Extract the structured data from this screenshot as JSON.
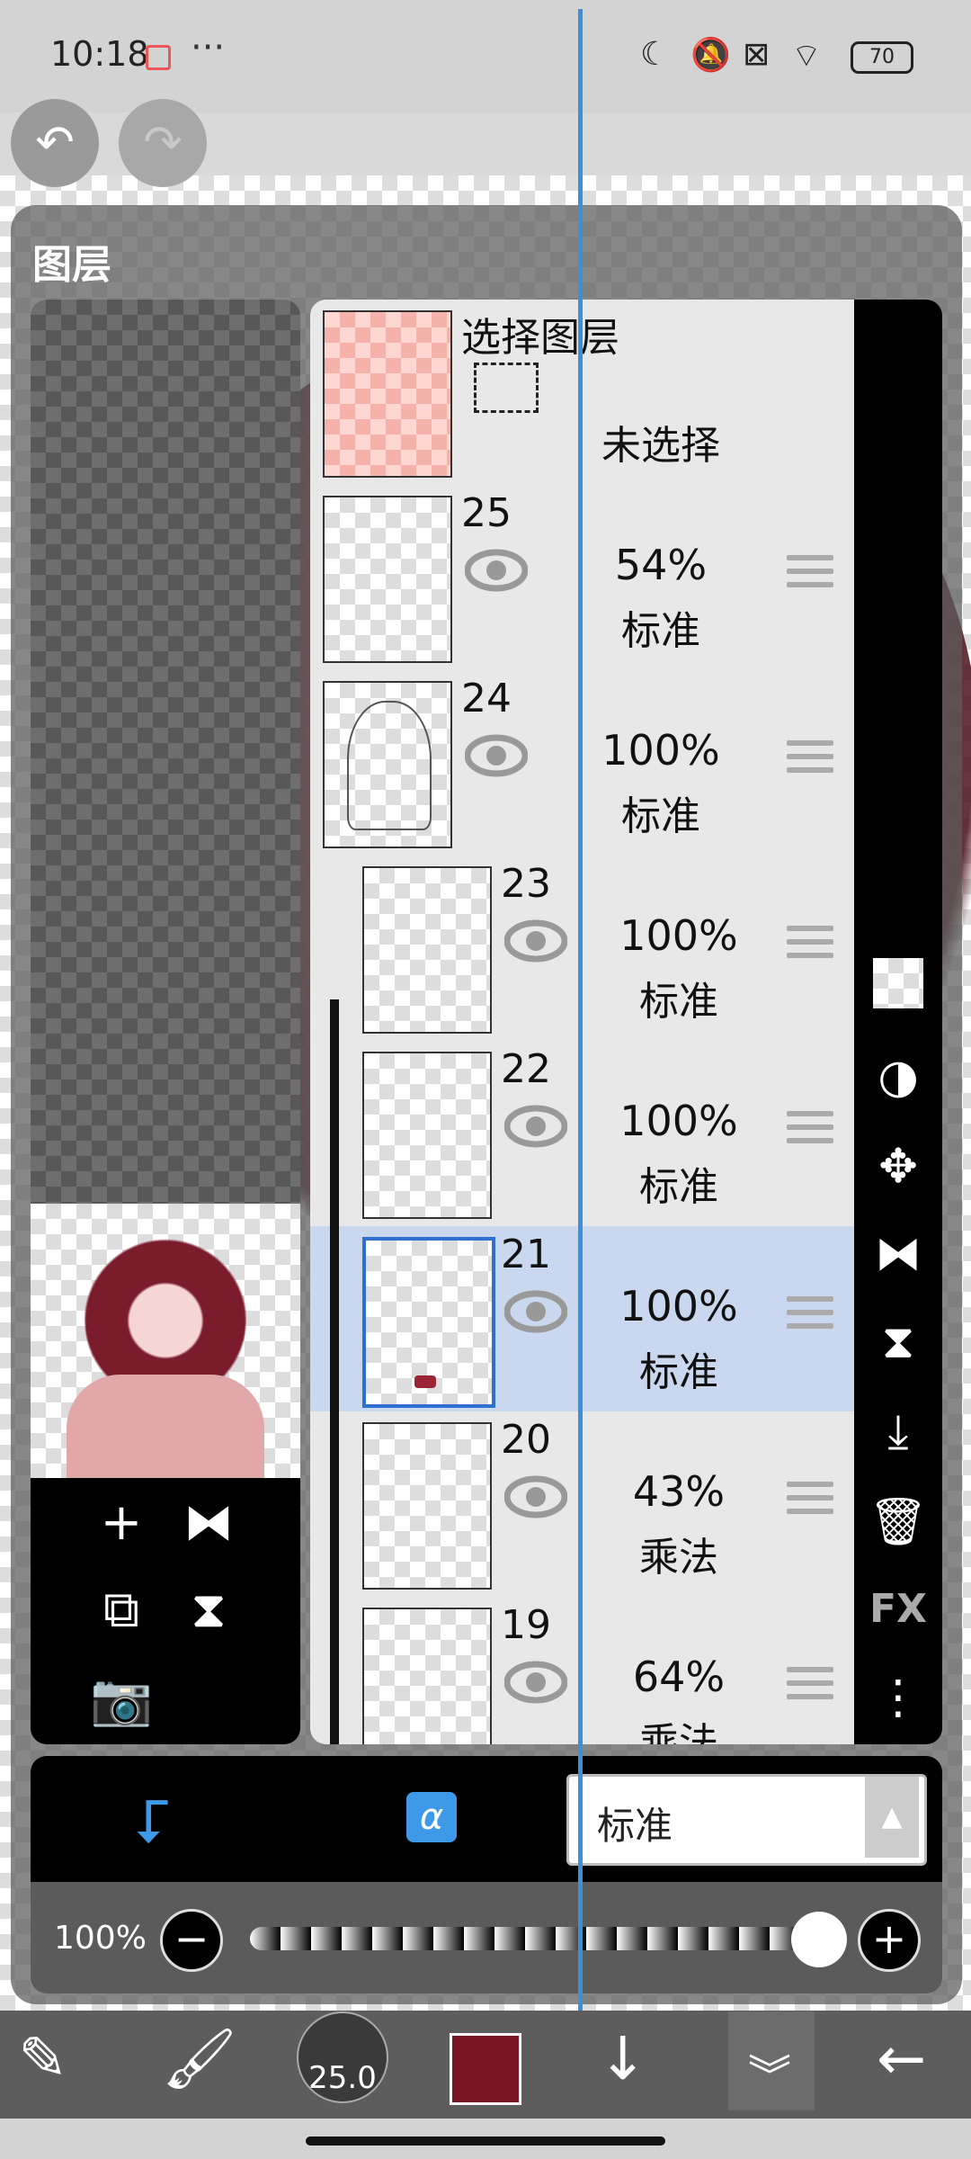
{
  "status_bar": {
    "time": "10:18",
    "dots": "···",
    "battery": "70"
  },
  "panel": {
    "title": "图层"
  },
  "selection_layer": {
    "title": "选择图层",
    "status": "未选择"
  },
  "layers": [
    {
      "name": "25",
      "opacity": "54%",
      "blend": "标准",
      "clipped": false,
      "selected": false
    },
    {
      "name": "24",
      "opacity": "100%",
      "blend": "标准",
      "clipped": false,
      "selected": false
    },
    {
      "name": "23",
      "opacity": "100%",
      "blend": "标准",
      "clipped": true,
      "selected": false
    },
    {
      "name": "22",
      "opacity": "100%",
      "blend": "标准",
      "clipped": true,
      "selected": false
    },
    {
      "name": "21",
      "opacity": "100%",
      "blend": "标准",
      "clipped": true,
      "selected": true
    },
    {
      "name": "20",
      "opacity": "43%",
      "blend": "乘法",
      "clipped": true,
      "selected": false
    },
    {
      "name": "19",
      "opacity": "64%",
      "blend": "乘法",
      "clipped": true,
      "selected": false
    }
  ],
  "right_toolbar": {
    "fx_label": "FX",
    "icons": [
      "checkerboard-icon",
      "half-circle-icon",
      "move-icon",
      "flip-horizontal-icon",
      "flip-vertical-icon",
      "merge-down-icon",
      "trash-icon",
      "fx-icon",
      "more-icon"
    ]
  },
  "mode_bar": {
    "blend_mode": "标准",
    "alpha_symbol": "α"
  },
  "opacity_bar": {
    "label": "100%",
    "value": 1.0
  },
  "bottom_toolbar": {
    "brush_size": "25.0",
    "color": "#7a1523"
  },
  "colors": {
    "accent": "#3e9ae8",
    "selected_row": "#c9d8ee",
    "guide_line": "#3d8fdc"
  }
}
